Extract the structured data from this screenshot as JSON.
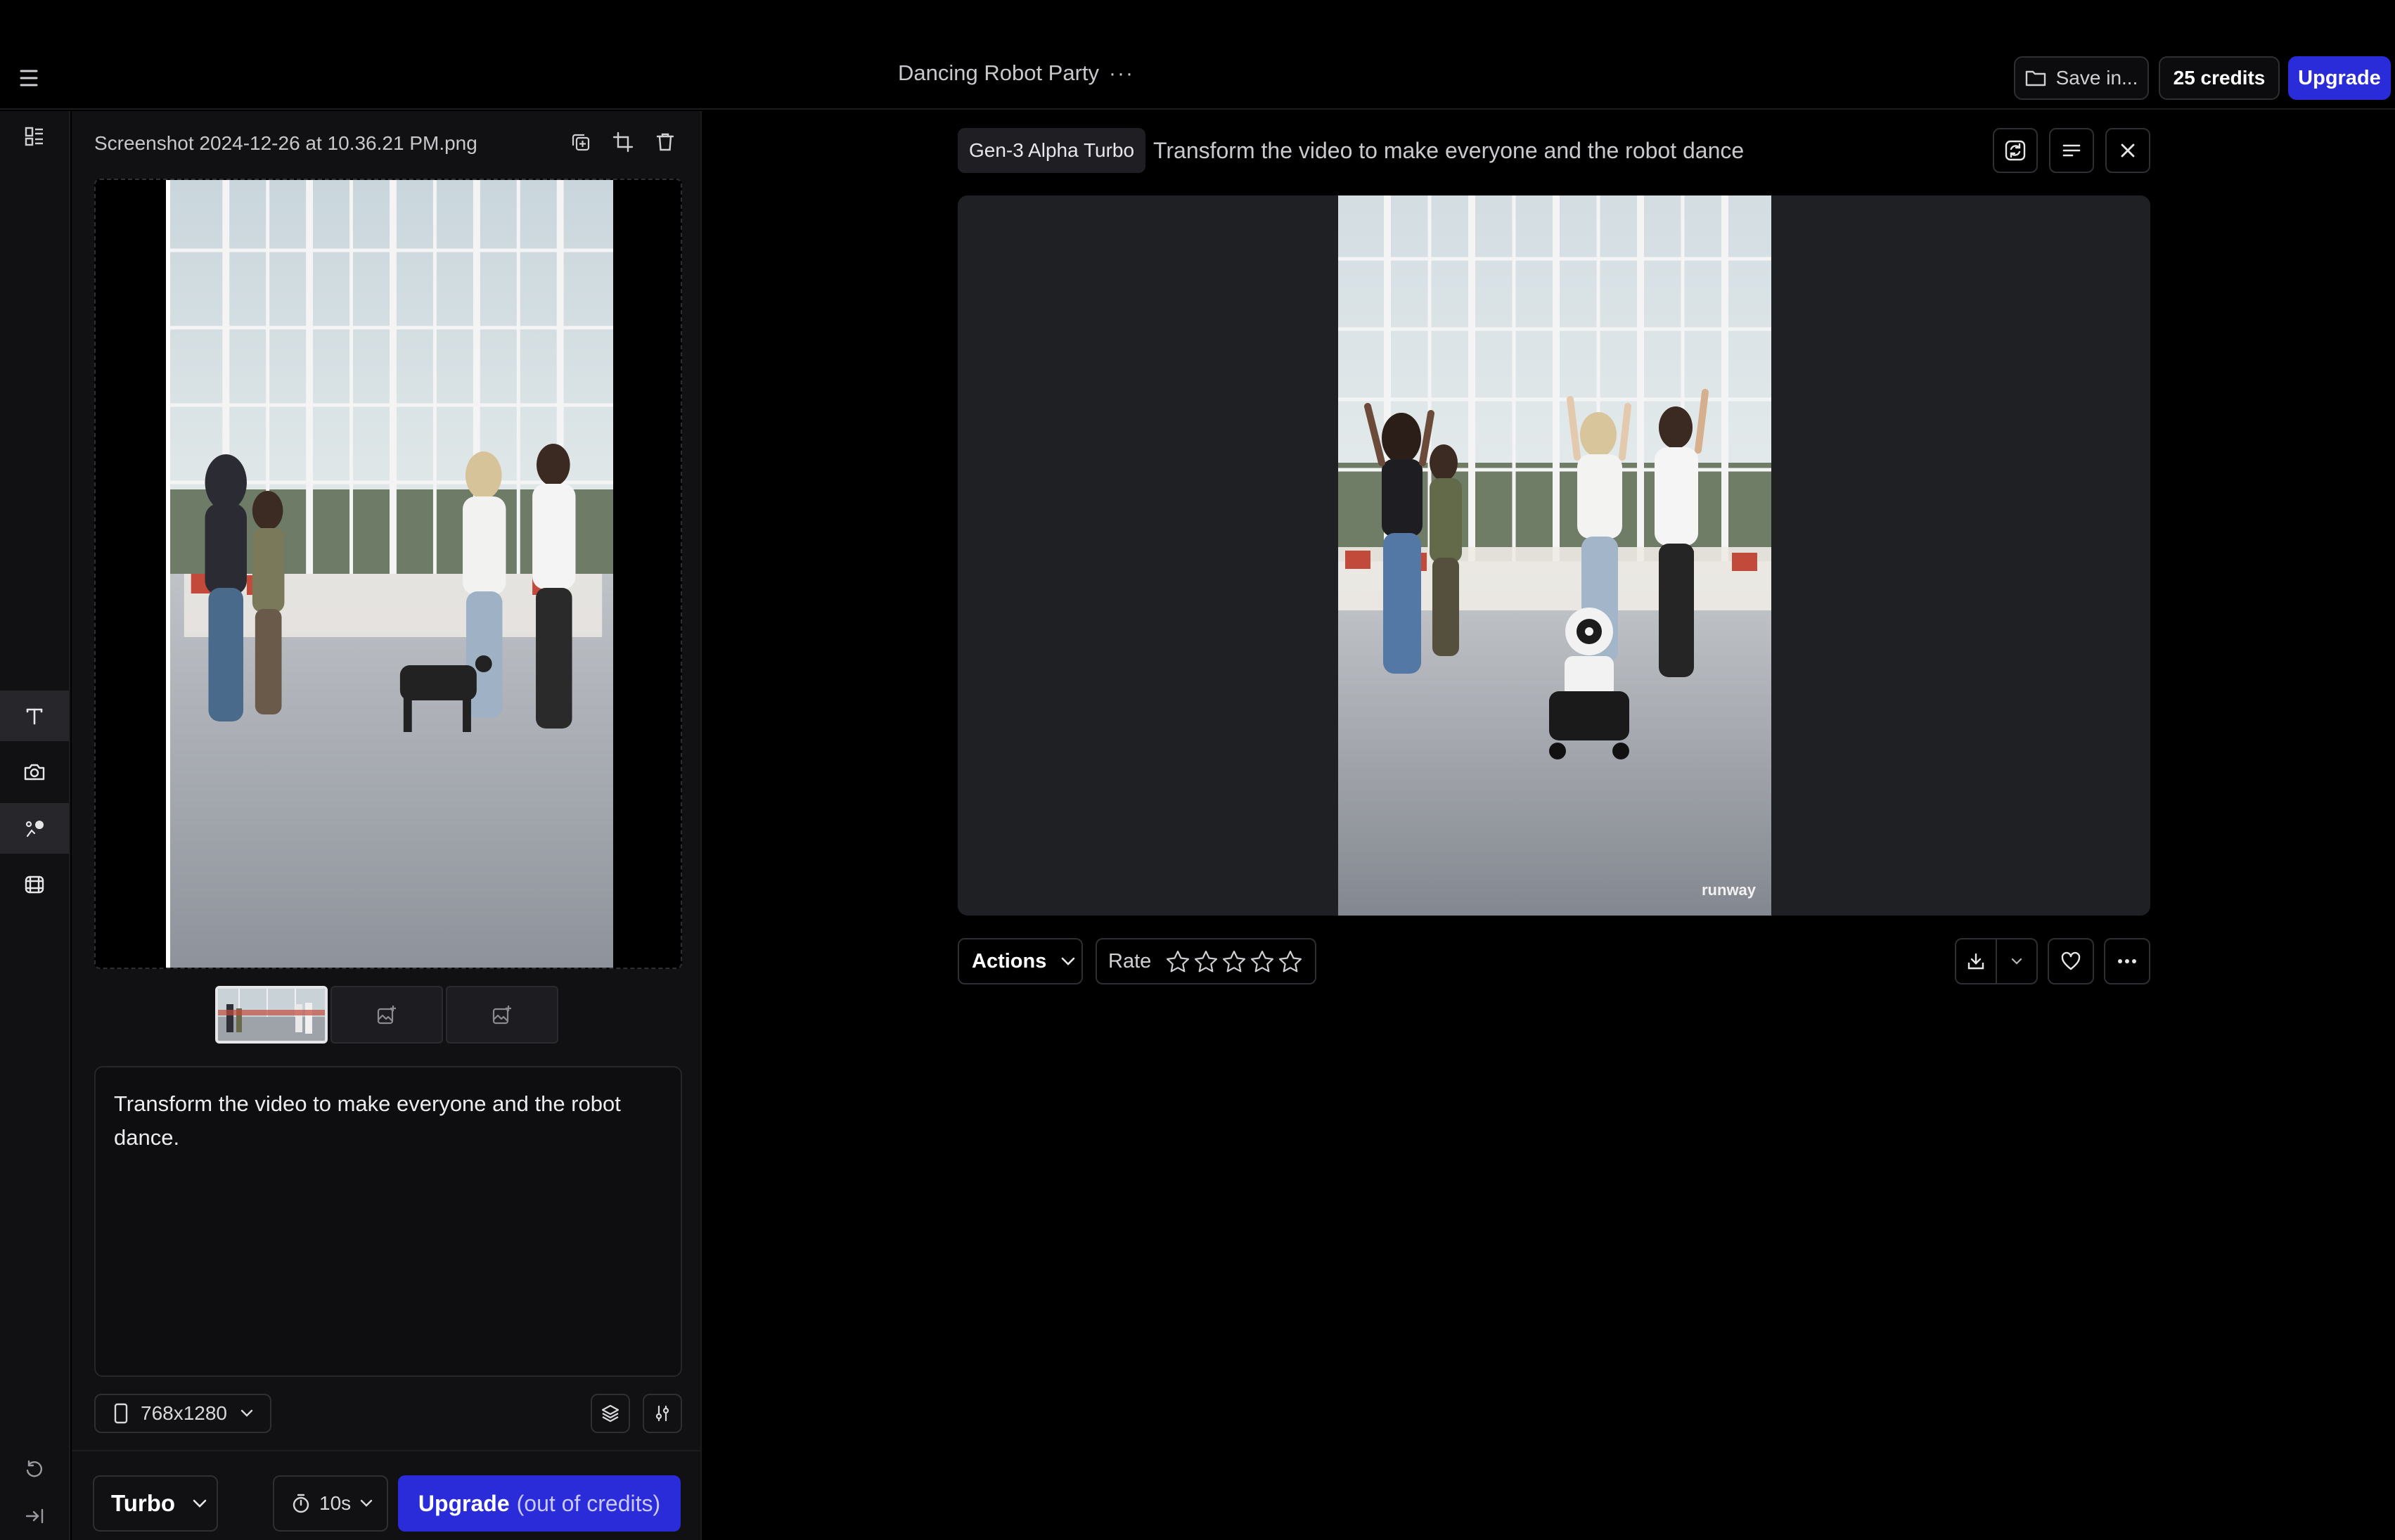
{
  "header": {
    "project_title": "Dancing Robot Party",
    "more_icon": "more-horizontal-icon",
    "save_label": "Save in...",
    "credits_label": "25 credits",
    "upgrade_label": "Upgrade"
  },
  "left_rail": {
    "items": [
      "menu-icon",
      "assets-icon",
      "text-tool-icon",
      "camera-icon",
      "motion-brush-icon",
      "frames-icon",
      "undo-icon",
      "collapse-icon"
    ]
  },
  "input_panel": {
    "file_name": "Screenshot 2024-12-26 at 10.36.21 PM.png",
    "prompt_text": "Transform the video to make everyone and the robot dance.",
    "resolution": "768x1280",
    "model": "Turbo",
    "duration": "10s",
    "generate_label": "Upgrade",
    "generate_note": "(out of credits)"
  },
  "result": {
    "model_chip": "Gen-3 Alpha Turbo",
    "prompt": "Transform the video to make everyone and the robot dance",
    "watermark": "runway",
    "actions_label": "Actions",
    "rate_label": "Rate",
    "stars": 5,
    "rating": 0
  },
  "colors": {
    "accent": "#2a2bd9",
    "background": "#000000",
    "panel": "#111114",
    "border": "#2e2e33"
  }
}
